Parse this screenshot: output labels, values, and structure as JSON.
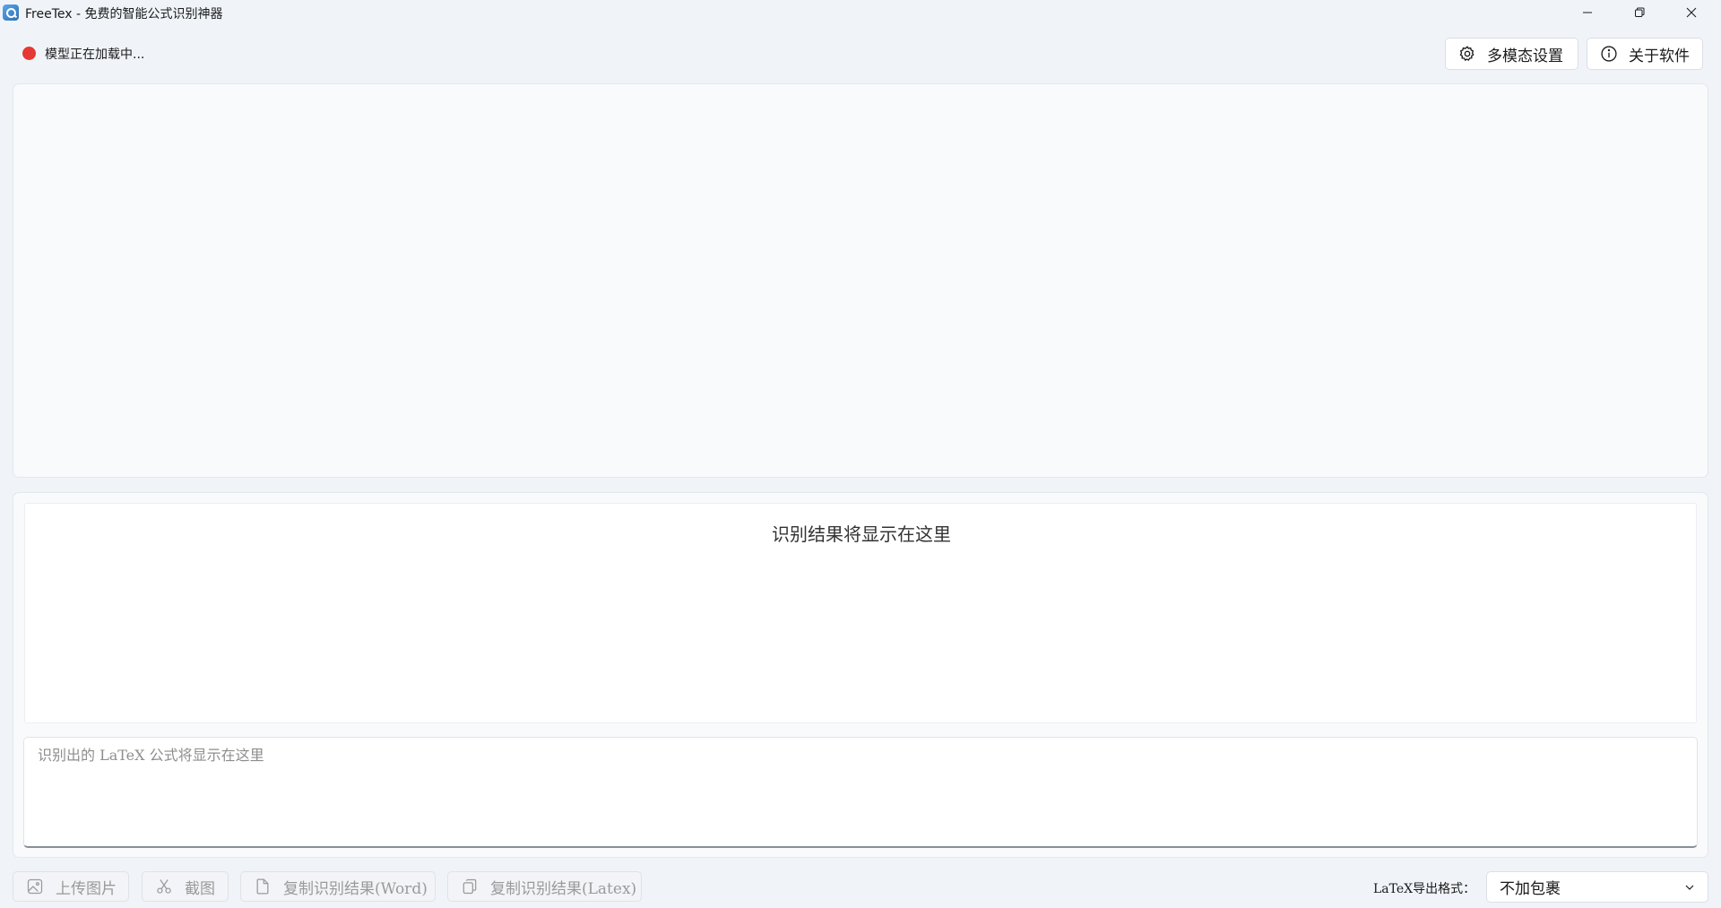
{
  "window": {
    "title": "FreeTex - 免费的智能公式识别神器"
  },
  "status": {
    "text": "模型正在加载中...",
    "color": "#e53935"
  },
  "header": {
    "settings_label": "多模态设置",
    "about_label": "关于软件"
  },
  "result": {
    "render_placeholder": "识别结果将显示在这里",
    "latex_placeholder": "识别出的 LaTeX 公式将显示在这里"
  },
  "toolbar": {
    "upload_label": "上传图片",
    "screenshot_label": "截图",
    "copy_word_label": "复制识别结果(Word)",
    "copy_latex_label": "复制识别结果(Latex)"
  },
  "export": {
    "label": "LaTeX导出格式：",
    "selected": "不加包裹"
  },
  "icons": {
    "settings": "gear-icon",
    "about": "info-icon",
    "upload": "image-icon",
    "screenshot": "scissors-icon",
    "copy_word": "document-icon",
    "copy_latex": "copy-icon",
    "dropdown": "chevron-down-icon"
  }
}
